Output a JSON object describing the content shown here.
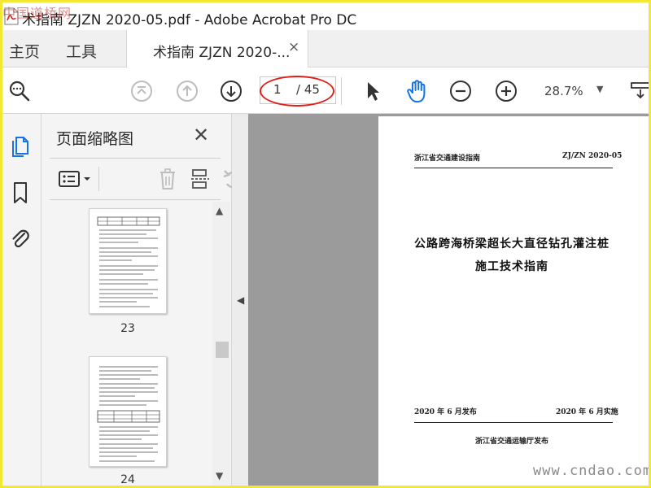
{
  "window": {
    "title": "术指南 ZJZN 2020-05.pdf - Adobe Acrobat Pro DC",
    "watermark_top": "中国道桥网",
    "watermark_bottom": "www.cndao.com"
  },
  "tabs": {
    "home": "主页",
    "tools": "工具",
    "document": "术指南 ZJZN 2020-...",
    "close_symbol": "×"
  },
  "toolbar": {
    "page_current": "1",
    "page_total": "/ 45",
    "zoom": "28.7%",
    "zoom_caret": "▼"
  },
  "thumbnails": {
    "title": "页面缩略图",
    "close_symbol": "✕",
    "pages": [
      {
        "number": "23"
      },
      {
        "number": "24"
      }
    ]
  },
  "document": {
    "header_left": "浙江省交通建设指南",
    "header_right": "ZJ/ZN 2020-05",
    "title_line1": "公路跨海桥梁超长大直径钻孔灌注桩",
    "title_line2": "施工技术指南",
    "published": "2020 年 6 月发布",
    "implemented": "2020 年 6 月实施",
    "issuer": "浙江省交通运输厅发布"
  },
  "colors": {
    "accent_blue": "#1473e6",
    "annotation_red": "#e0201a",
    "border_yellow": "#f2e832"
  }
}
